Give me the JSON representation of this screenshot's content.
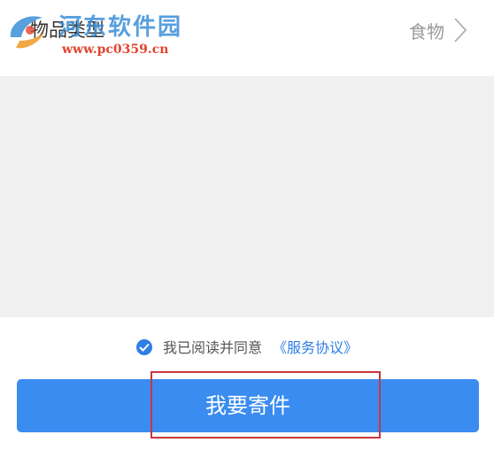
{
  "item_row": {
    "label": "物品类型",
    "value": "食物"
  },
  "watermark": {
    "title": "河东软件园",
    "url": "www.pc0359.cn"
  },
  "agreement": {
    "text": "我已阅读并同意",
    "link": "《服务协议》",
    "checked": true
  },
  "submit_button": {
    "label": "我要寄件"
  },
  "colors": {
    "accent": "#3a8cf0",
    "highlight_border": "#c8363c",
    "gray_area": "#f0f0f0"
  },
  "icons": {
    "chevron": "chevron-right-icon",
    "check": "check-circle-icon",
    "logo": "watermark-logo-icon"
  }
}
